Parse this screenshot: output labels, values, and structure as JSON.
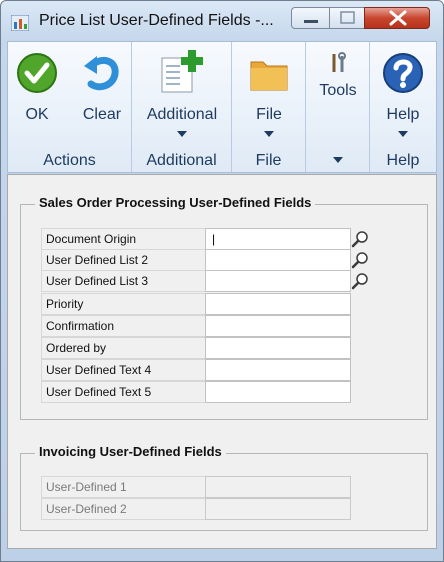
{
  "window": {
    "title": "Price List User-Defined Fields  -..."
  },
  "ribbon": {
    "groups": [
      {
        "label": "Actions",
        "buttons": [
          {
            "label": "OK",
            "icon": "ok-check-icon"
          },
          {
            "label": "Clear",
            "icon": "clear-undo-icon"
          }
        ]
      },
      {
        "label": "Additional",
        "buttons": [
          {
            "label": "Additional",
            "icon": "additional-add-icon"
          }
        ]
      },
      {
        "label": "File",
        "buttons": [
          {
            "label": "File",
            "icon": "folder-icon"
          }
        ]
      },
      {
        "label": "",
        "buttons": [
          {
            "label": "Tools",
            "icon": "tools-icon"
          }
        ]
      },
      {
        "label": "Help",
        "buttons": [
          {
            "label": "Help",
            "icon": "help-icon"
          }
        ]
      }
    ]
  },
  "sop": {
    "title": "Sales Order Processing User-Defined Fields",
    "fields": [
      {
        "label": "Document Origin",
        "value": "|"
      },
      {
        "label": "User Defined List 2",
        "value": ""
      },
      {
        "label": "User Defined List 3",
        "value": ""
      },
      {
        "label": "Priority",
        "value": ""
      },
      {
        "label": "Confirmation",
        "value": ""
      },
      {
        "label": "Ordered by",
        "value": ""
      },
      {
        "label": "User Defined Text 4",
        "value": ""
      },
      {
        "label": "User Defined Text 5",
        "value": ""
      }
    ]
  },
  "invoicing": {
    "title": "Invoicing User-Defined Fields",
    "fields": [
      {
        "label": "User-Defined 1",
        "value": ""
      },
      {
        "label": "User-Defined 2",
        "value": ""
      }
    ]
  }
}
